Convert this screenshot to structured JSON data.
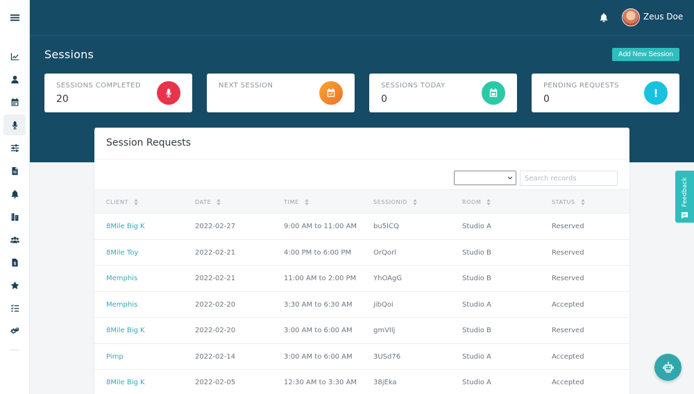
{
  "header": {
    "username": "Zeus Doe"
  },
  "sidebar": {
    "items": [
      {
        "icon": "menu-icon"
      },
      {
        "icon": "chart-line-icon"
      },
      {
        "icon": "user-icon"
      },
      {
        "icon": "calendar-icon"
      },
      {
        "icon": "microphone-icon",
        "active": true
      },
      {
        "icon": "sliders-icon"
      },
      {
        "icon": "file-invoice-icon"
      },
      {
        "icon": "bell-icon"
      },
      {
        "icon": "building-icon"
      },
      {
        "icon": "users-icon"
      },
      {
        "icon": "file-dollar-icon"
      },
      {
        "icon": "star-icon"
      },
      {
        "icon": "tasks-icon"
      },
      {
        "icon": "cogs-icon"
      }
    ]
  },
  "page": {
    "title": "Sessions",
    "add_button": "Add New Session"
  },
  "stats": [
    {
      "label": "SESSIONS COMPLETED",
      "value": "20",
      "icon": "microphone-icon",
      "color": "#e8334a"
    },
    {
      "label": "NEXT SESSION",
      "value": "",
      "icon": "calendar-check-icon",
      "color": "#f58a2a"
    },
    {
      "label": "SESSIONS TODAY",
      "value": "0",
      "icon": "calendar-icon",
      "color": "#2cc9a6"
    },
    {
      "label": "PENDING REQUESTS",
      "value": "0",
      "icon": "exclamation-icon",
      "color": "#19c1e0"
    }
  ],
  "requests": {
    "title": "Session Requests",
    "search_placeholder": "Search records",
    "columns": [
      "CLIENT",
      "DATE",
      "TIME",
      "SESSIONID",
      "ROOM",
      "STATUS"
    ],
    "rows": [
      [
        "8Mile Big K",
        "2022-02-27",
        "9:00 AM to 11:00 AM",
        "bu5ICQ",
        "Studio A",
        "Reserved"
      ],
      [
        "8Mile Toy",
        "2022-02-21",
        "4:00 PM to 6:00 PM",
        "OrQorl",
        "Studio B",
        "Reserved"
      ],
      [
        "Memphis",
        "2022-02-21",
        "11:00 AM to 2:00 PM",
        "YhOAgG",
        "Studio B",
        "Reserved"
      ],
      [
        "Memphis",
        "2022-02-20",
        "3:30 AM to 6:30 AM",
        "jibQoi",
        "Studio A",
        "Accepted"
      ],
      [
        "8Mile Big K",
        "2022-02-20",
        "3:00 AM to 6:00 AM",
        "gmVIlj",
        "Studio B",
        "Reserved"
      ],
      [
        "Pimp",
        "2022-02-14",
        "3:00 AM to 6:00 AM",
        "3USd76",
        "Studio A",
        "Accepted"
      ],
      [
        "8Mile Big K",
        "2022-02-05",
        "12:30 AM to 3:30 AM",
        "38jEka",
        "Studio A",
        "Accepted"
      ]
    ]
  },
  "feedback": {
    "label": "Feedback"
  },
  "colors": {
    "primary": "#164b66",
    "accent": "#2fbdbd",
    "link": "#35a8b8"
  }
}
